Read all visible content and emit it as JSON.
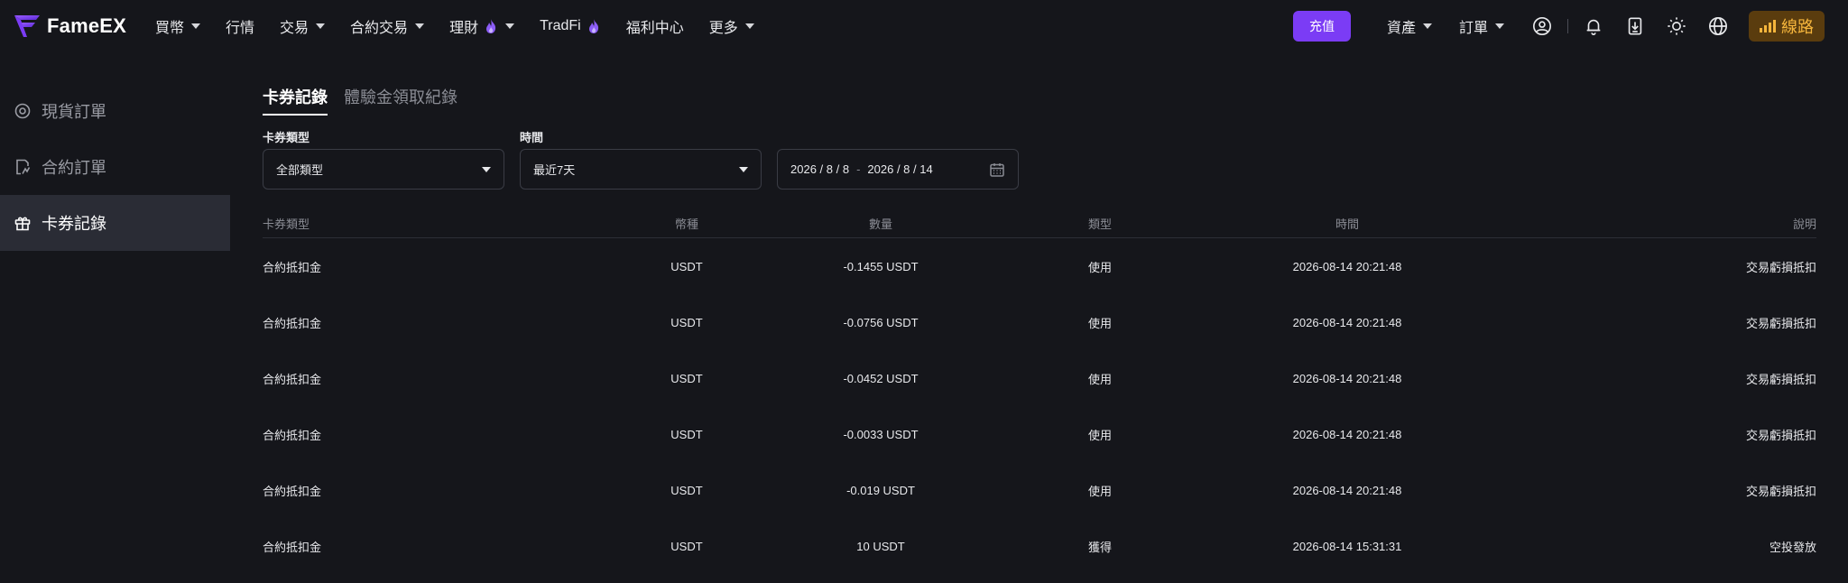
{
  "brand": {
    "name": "FameEX"
  },
  "nav": [
    {
      "label": "買幣",
      "caret": true,
      "flame": false
    },
    {
      "label": "行情",
      "caret": false,
      "flame": false
    },
    {
      "label": "交易",
      "caret": true,
      "flame": false
    },
    {
      "label": "合約交易",
      "caret": true,
      "flame": false
    },
    {
      "label": "理財",
      "caret": true,
      "flame": true
    },
    {
      "label": "TradFi",
      "caret": false,
      "flame": true
    },
    {
      "label": "福利中心",
      "caret": false,
      "flame": false
    },
    {
      "label": "更多",
      "caret": true,
      "flame": false
    }
  ],
  "header": {
    "deposit_label": "充值",
    "assets_label": "資產",
    "orders_label": "訂單",
    "line_label": "線路"
  },
  "sidebar": {
    "items": [
      {
        "label": "現貨訂單",
        "icon": "spot-order-icon",
        "active": false
      },
      {
        "label": "合約訂單",
        "icon": "contract-order-icon",
        "active": false
      },
      {
        "label": "卡券記錄",
        "icon": "gift-icon",
        "active": true
      }
    ]
  },
  "tabs": [
    {
      "label": "卡券記錄",
      "active": true
    },
    {
      "label": "體驗金領取紀錄",
      "active": false
    }
  ],
  "filters": {
    "coupon_type_label": "卡券類型",
    "coupon_type_value": "全部類型",
    "time_label": "時間",
    "time_value": "最近7天",
    "date_start": "2026 / 8 / 8",
    "date_sep": "-",
    "date_end": "2026 / 8 / 14"
  },
  "table": {
    "headers": [
      "卡券類型",
      "幣種",
      "數量",
      "類型",
      "時間",
      "說明"
    ],
    "rows": [
      [
        "合約抵扣金",
        "USDT",
        "-0.1455 USDT",
        "使用",
        "2026-08-14 20:21:48",
        "交易虧損抵扣"
      ],
      [
        "合約抵扣金",
        "USDT",
        "-0.0756 USDT",
        "使用",
        "2026-08-14 20:21:48",
        "交易虧損抵扣"
      ],
      [
        "合約抵扣金",
        "USDT",
        "-0.0452 USDT",
        "使用",
        "2026-08-14 20:21:48",
        "交易虧損抵扣"
      ],
      [
        "合約抵扣金",
        "USDT",
        "-0.0033 USDT",
        "使用",
        "2026-08-14 20:21:48",
        "交易虧損抵扣"
      ],
      [
        "合約抵扣金",
        "USDT",
        "-0.019 USDT",
        "使用",
        "2026-08-14 20:21:48",
        "交易虧損抵扣"
      ],
      [
        "合約抵扣金",
        "USDT",
        "10 USDT",
        "獲得",
        "2026-08-14 15:31:31",
        "空投發放"
      ]
    ]
  },
  "colors": {
    "background": "#15161b",
    "accent": "#7b3cf5",
    "line_button_bg": "#5a3c0e",
    "line_button_text": "#f5b53c",
    "sidebar_active": "#2a2c35"
  }
}
